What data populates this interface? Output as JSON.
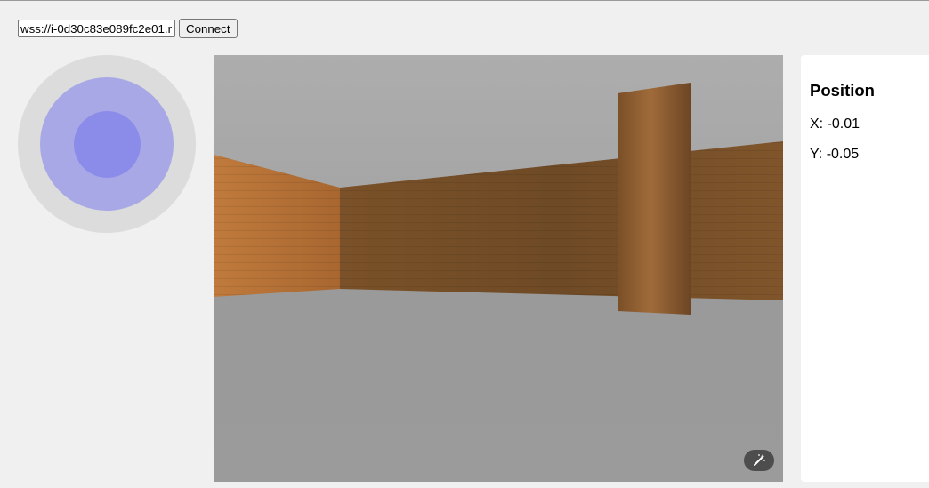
{
  "connection": {
    "url_value": "wss://i-0d30c83e089fc2e01.r",
    "connect_label": "Connect"
  },
  "joystick": {
    "knob_offset": {
      "x": 0.0,
      "y": 0.0
    }
  },
  "viewport": {
    "magic_icon": "magic-wand-icon"
  },
  "position_panel": {
    "title": "Position",
    "x_label": "X:",
    "x_value": "-0.01",
    "y_label": "Y:",
    "y_value": "-0.05"
  },
  "colors": {
    "joystick_base": "#dcdcdc",
    "joystick_ring": "#a8a8e6",
    "joystick_knob": "#8b8cea",
    "wall_wood": "#8a5a2e",
    "floor": "#9b9b9b",
    "ceiling": "#adadad"
  }
}
